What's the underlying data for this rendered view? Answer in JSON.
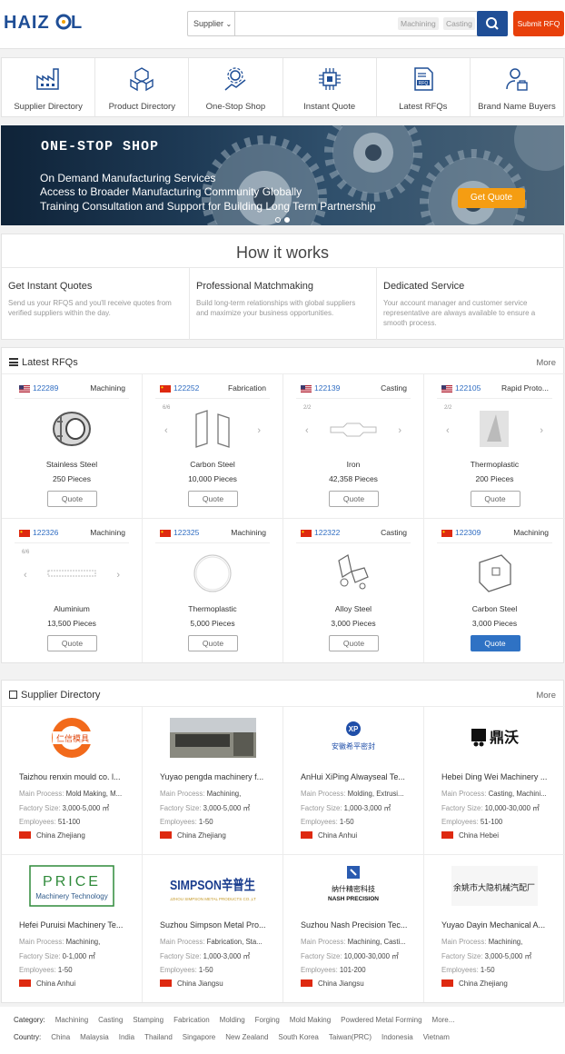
{
  "header": {
    "logo_text": "HAIZOL",
    "search_type": "Supplier",
    "search_placeholder": "",
    "chips": [
      "Machining",
      "Casting"
    ],
    "submit_rfq": "Submit RFQ"
  },
  "nav": [
    {
      "label": "Supplier Directory",
      "icon": "factory-icon"
    },
    {
      "label": "Product Directory",
      "icon": "boxes-icon"
    },
    {
      "label": "One-Stop Shop",
      "icon": "gear-chart-icon"
    },
    {
      "label": "Instant Quote",
      "icon": "chip-icon"
    },
    {
      "label": "Latest RFQs",
      "icon": "rfq-document-icon"
    },
    {
      "label": "Brand Name Buyers",
      "icon": "buyer-icon"
    }
  ],
  "banner": {
    "heading": "ONE-STOP SHOP",
    "lines": [
      "On Demand Manufacturing Services",
      "Access to Broader Manufacturing Community Globally",
      "Training Consultation and Support for Building Long Term Partnership"
    ],
    "cta": "Get Quote"
  },
  "how": {
    "title": "How it works",
    "items": [
      {
        "title": "Get Instant Quotes",
        "desc": "Send us your RFQS and you'll receive quotes from verified suppliers within the day."
      },
      {
        "title": "Professional Matchmaking",
        "desc": "Build long-term relationships with global suppliers and maximize your business opportunities."
      },
      {
        "title": "Dedicated Service",
        "desc": "Your account manager and customer service representative are always available to ensure a smooth process."
      }
    ]
  },
  "rfqs": {
    "title": "Latest RFQs",
    "more": "More",
    "items": [
      {
        "flag": "us",
        "id": "122289",
        "category": "Machining",
        "material": "Stainless Steel",
        "qty": "250 Pieces",
        "pager": "",
        "quote": "Quote"
      },
      {
        "flag": "cn",
        "id": "122252",
        "category": "Fabrication",
        "material": "Carbon Steel",
        "qty": "10,000 Pieces",
        "pager": "6/6",
        "quote": "Quote"
      },
      {
        "flag": "us",
        "id": "122139",
        "category": "Casting",
        "material": "Iron",
        "qty": "42,358 Pieces",
        "pager": "2/2",
        "quote": "Quote"
      },
      {
        "flag": "us",
        "id": "122105",
        "category": "Rapid Proto...",
        "material": "Thermoplastic",
        "qty": "200 Pieces",
        "pager": "2/2",
        "quote": "Quote"
      },
      {
        "flag": "cn",
        "id": "122326",
        "category": "Machining",
        "material": "Aluminium",
        "qty": "13,500 Pieces",
        "pager": "6/6",
        "quote": "Quote"
      },
      {
        "flag": "cn",
        "id": "122325",
        "category": "Machining",
        "material": "Thermoplastic",
        "qty": "5,000 Pieces",
        "pager": "",
        "quote": "Quote"
      },
      {
        "flag": "cn",
        "id": "122322",
        "category": "Casting",
        "material": "Alloy Steel",
        "qty": "3,000 Pieces",
        "pager": "",
        "quote": "Quote"
      },
      {
        "flag": "cn",
        "id": "122309",
        "category": "Machining",
        "material": "Carbon Steel",
        "qty": "3,000 Pieces",
        "pager": "",
        "quote": "Quote"
      }
    ]
  },
  "suppliers": {
    "title": "Supplier Directory",
    "more": "More",
    "labels": {
      "process": "Main Process:",
      "size": "Factory Size:",
      "emp": "Employees:"
    },
    "items": [
      {
        "name": "Taizhou renxin mould co. l...",
        "process": "Mold Making, M...",
        "size": "3,000-5,000 ㎡",
        "emp": "51-100",
        "loc": "China Zhejiang",
        "logo": "仁信模具"
      },
      {
        "name": "Yuyao pengda machinery f...",
        "process": "Machining,",
        "size": "3,000-5,000 ㎡",
        "emp": "1-50",
        "loc": "China Zhejiang",
        "logo": ""
      },
      {
        "name": "AnHui XiPing Alwayseal Te...",
        "process": "Molding, Extrusi...",
        "size": "1,000-3,000 ㎡",
        "emp": "1-50",
        "loc": "China Anhui",
        "logo": "安徽希平密封"
      },
      {
        "name": "Hebei Ding Wei Machinery ...",
        "process": "Casting, Machini...",
        "size": "10,000-30,000 ㎡",
        "emp": "51-100",
        "loc": "China Hebei",
        "logo": "鼎沃"
      },
      {
        "name": "Hefei Puruisi Machinery Te...",
        "process": "Machining,",
        "size": "0-1,000 ㎡",
        "emp": "1-50",
        "loc": "China Anhui",
        "logo": "PRICE",
        "logo_sub": "Machinery Technology"
      },
      {
        "name": "Suzhou Simpson Metal Pro...",
        "process": "Fabrication, Sta...",
        "size": "1,000-3,000 ㎡",
        "emp": "1-50",
        "loc": "China Jiangsu",
        "logo": "SIMPSON辛普生",
        "logo_sub": "SUZHOU SIMPSON METAL PRODUCTS CO.,LTD"
      },
      {
        "name": "Suzhou Nash Precision Tec...",
        "process": "Machining, Casti...",
        "size": "10,000-30,000 ㎡",
        "emp": "101-200",
        "loc": "China Jiangsu",
        "logo": "纳什精密科技",
        "logo_sub": "NASH PRECISION"
      },
      {
        "name": "Yuyao Dayin Mechanical A...",
        "process": "Machining,",
        "size": "3,000-5,000 ㎡",
        "emp": "1-50",
        "loc": "China Zhejiang",
        "logo": "余姚市大隐机械汽配厂"
      }
    ]
  },
  "footer": {
    "category_label": "Category:",
    "categories": [
      "Machining",
      "Casting",
      "Stamping",
      "Fabrication",
      "Molding",
      "Forging",
      "Mold Making",
      "Powdered Metal Forming",
      "More..."
    ],
    "country_label": "Country:",
    "countries": [
      "China",
      "Malaysia",
      "India",
      "Thailand",
      "Singapore",
      "New Zealand",
      "South Korea",
      "Taiwan(PRC)",
      "Indonesia",
      "Vietnam"
    ]
  },
  "colors": {
    "brand_blue": "#1f4e96",
    "accent_orange": "#e8400b",
    "cta_orange": "#f59d12",
    "link_blue": "#2e6cc2"
  }
}
